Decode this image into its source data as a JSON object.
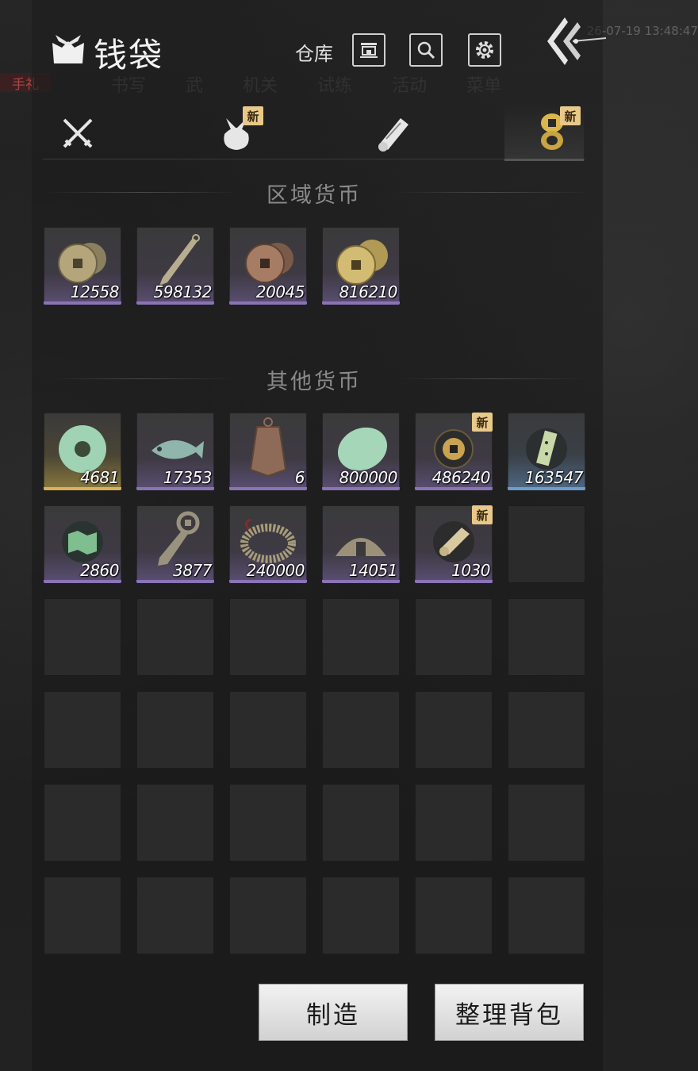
{
  "header": {
    "title": "钱袋",
    "warehouse_label": "仓库",
    "background_tag": "手礼",
    "background_timestamp": "26-07-19 13:48:47",
    "background_menu": [
      "书写",
      "武",
      "机关",
      "试练",
      "活动",
      "菜单"
    ]
  },
  "tabs": [
    {
      "icon": "crossed-swords-icon",
      "new": false,
      "active": false
    },
    {
      "icon": "cloth-bundle-icon",
      "new": true,
      "badge": "新",
      "active": false
    },
    {
      "icon": "scroll-icon",
      "new": false,
      "active": false
    },
    {
      "icon": "coin-stack-icon",
      "new": true,
      "badge": "新",
      "active": true
    }
  ],
  "sections": {
    "regional": {
      "title": "区域货币"
    },
    "other": {
      "title": "其他货币"
    }
  },
  "regional_items": [
    {
      "icon": "bronze-coins-icon",
      "qty": "12558",
      "rarity": "purple"
    },
    {
      "icon": "knife-money-icon",
      "qty": "598132",
      "rarity": "purple"
    },
    {
      "icon": "copper-coins-icon",
      "qty": "20045",
      "rarity": "purple"
    },
    {
      "icon": "gold-coins-icon",
      "qty": "816210",
      "rarity": "purple"
    }
  ],
  "other_items": [
    {
      "icon": "jade-bi-disc-icon",
      "qty": "4681",
      "rarity": "gold"
    },
    {
      "icon": "jade-fish-icon",
      "qty": "17353",
      "rarity": "purple"
    },
    {
      "icon": "bronze-token-icon",
      "qty": "6",
      "rarity": "purple"
    },
    {
      "icon": "jade-stone-icon",
      "qty": "800000",
      "rarity": "purple"
    },
    {
      "icon": "square-hole-coin-icon",
      "qty": "486240",
      "rarity": "purple",
      "new": true,
      "badge": "新"
    },
    {
      "icon": "jade-tablet-icon",
      "qty": "163547",
      "rarity": "blue"
    },
    {
      "icon": "map-fragment-icon",
      "qty": "2860",
      "rarity": "purple"
    },
    {
      "icon": "spade-money-icon",
      "qty": "3877",
      "rarity": "purple"
    },
    {
      "icon": "coin-string-icon",
      "qty": "240000",
      "rarity": "purple"
    },
    {
      "icon": "half-coin-icon",
      "qty": "14051",
      "rarity": "purple"
    },
    {
      "icon": "paper-roll-icon",
      "qty": "1030",
      "rarity": "purple",
      "new": true,
      "badge": "新"
    }
  ],
  "empty_slot_count": 25,
  "buttons": {
    "craft": "制造",
    "sort": "整理背包"
  },
  "colors": {
    "purple_rarity": "#8b73b6",
    "gold_rarity": "#d8b15a",
    "blue_rarity": "#6e9ccc",
    "new_badge": "#e8c98a"
  }
}
